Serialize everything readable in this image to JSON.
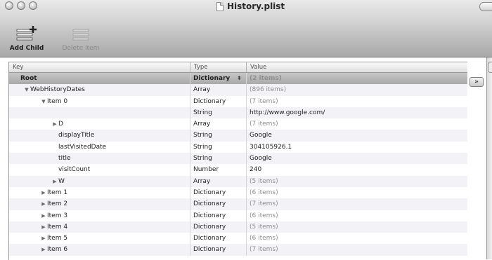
{
  "window": {
    "title": "History.plist"
  },
  "toolbar": {
    "add_child_label": "Add Child",
    "delete_item_label": "Delete Item"
  },
  "columns": {
    "key": "Key",
    "type": "Type",
    "value": "Value"
  },
  "expand_button_label": "»",
  "rows": [
    {
      "key": "Root",
      "type": "Dictionary",
      "value": "(2 items)",
      "selected": true
    },
    {
      "key": "WebHistoryDates",
      "type": "Array",
      "value": "(896 items)",
      "disclosure": "open"
    },
    {
      "key": "Item 0",
      "type": "Dictionary",
      "value": "(7 items)",
      "disclosure": "open"
    },
    {
      "key": "",
      "type": "String",
      "value": "http://www.google.com/"
    },
    {
      "key": "D",
      "type": "Array",
      "value": "(7 items)",
      "disclosure": "closed"
    },
    {
      "key": "displayTitle",
      "type": "String",
      "value": "Google"
    },
    {
      "key": "lastVisitedDate",
      "type": "String",
      "value": "304105926.1"
    },
    {
      "key": "title",
      "type": "String",
      "value": "Google"
    },
    {
      "key": "visitCount",
      "type": "Number",
      "value": "240"
    },
    {
      "key": "W",
      "type": "Array",
      "value": "(5 items)",
      "disclosure": "closed"
    },
    {
      "key": "Item 1",
      "type": "Dictionary",
      "value": "(6 items)",
      "disclosure": "closed"
    },
    {
      "key": "Item 2",
      "type": "Dictionary",
      "value": "(7 items)",
      "disclosure": "closed"
    },
    {
      "key": "Item 3",
      "type": "Dictionary",
      "value": "(6 items)",
      "disclosure": "closed"
    },
    {
      "key": "Item 4",
      "type": "Dictionary",
      "value": "(5 items)",
      "disclosure": "closed"
    },
    {
      "key": "Item 5",
      "type": "Dictionary",
      "value": "(6 items)",
      "disclosure": "closed"
    },
    {
      "key": "Item 6",
      "type": "Dictionary",
      "value": "(7 items)",
      "disclosure": "closed"
    }
  ]
}
